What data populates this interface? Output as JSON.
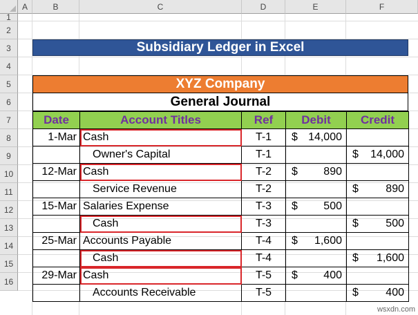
{
  "columns": [
    "A",
    "B",
    "C",
    "D",
    "E",
    "F"
  ],
  "rows": [
    "1",
    "2",
    "3",
    "4",
    "5",
    "6",
    "7",
    "8",
    "9",
    "10",
    "11",
    "12",
    "13",
    "14",
    "15",
    "16"
  ],
  "title": "Subsidiary Ledger in Excel",
  "company": "XYZ Company",
  "journal_title": "General Journal",
  "headers": {
    "date": "Date",
    "account": "Account Titles",
    "ref": "Ref",
    "debit": "Debit",
    "credit": "Credit"
  },
  "currency": "$",
  "entries": [
    {
      "date": "1-Mar",
      "account": "Cash",
      "ref": "T-1",
      "debit": "14,000",
      "credit": "",
      "highlight": true,
      "indent": false
    },
    {
      "date": "",
      "account": "Owner's Capital",
      "ref": "T-1",
      "debit": "",
      "credit": "14,000",
      "highlight": false,
      "indent": true
    },
    {
      "date": "12-Mar",
      "account": "Cash",
      "ref": "T-2",
      "debit": "890",
      "credit": "",
      "highlight": true,
      "indent": false
    },
    {
      "date": "",
      "account": "Service Revenue",
      "ref": "T-2",
      "debit": "",
      "credit": "890",
      "highlight": false,
      "indent": true
    },
    {
      "date": "15-Mar",
      "account": "Salaries Expense",
      "ref": "T-3",
      "debit": "500",
      "credit": "",
      "highlight": false,
      "indent": false
    },
    {
      "date": "",
      "account": "Cash",
      "ref": "T-3",
      "debit": "",
      "credit": "500",
      "highlight": true,
      "indent": true
    },
    {
      "date": "25-Mar",
      "account": "Accounts Payable",
      "ref": "T-4",
      "debit": "1,600",
      "credit": "",
      "highlight": false,
      "indent": false
    },
    {
      "date": "",
      "account": "Cash",
      "ref": "T-4",
      "debit": "",
      "credit": "1,600",
      "highlight": true,
      "indent": true
    },
    {
      "date": "29-Mar",
      "account": "Cash",
      "ref": "T-5",
      "debit": "400",
      "credit": "",
      "highlight": true,
      "indent": false
    },
    {
      "date": "",
      "account": "Accounts Receivable",
      "ref": "T-5",
      "debit": "",
      "credit": "400",
      "highlight": false,
      "indent": true
    }
  ],
  "watermark": "wsxdn.com",
  "colors": {
    "title_bg": "#2f5597",
    "company_bg": "#ed7d31",
    "header_bg": "#92d050",
    "header_text": "#7030a0",
    "highlight": "#d9262a"
  }
}
